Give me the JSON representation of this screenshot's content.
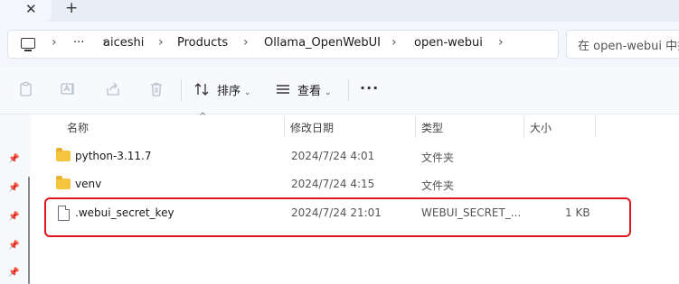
{
  "tabstrip": {
    "close_glyph": "✕",
    "new_tab_glyph": "+"
  },
  "breadcrumb": [
    "aiceshi",
    "Products",
    "Ollama_OpenWebUI",
    "open-webui"
  ],
  "breadcrumb_overflow": "···",
  "search": {
    "placeholder": "在 open-webui 中搜索"
  },
  "toolbar": {
    "sort_label": "排序",
    "view_label": "查看",
    "more_label": "···"
  },
  "columns": {
    "name": "名称",
    "modified": "修改日期",
    "type": "类型",
    "size": "大小"
  },
  "files": [
    {
      "name": "python-3.11.7",
      "modified": "2024/7/24 4:01",
      "type": "文件夹",
      "size": "",
      "icon": "folder-icon"
    },
    {
      "name": "venv",
      "modified": "2024/7/24 4:15",
      "type": "文件夹",
      "size": "",
      "icon": "folder-icon"
    },
    {
      "name": ".webui_secret_key",
      "modified": "2024/7/24 21:01",
      "type": "WEBUI_SECRET_...",
      "size": "1 KB",
      "icon": "file-icon",
      "highlighted": true
    }
  ],
  "highlight_color": "#e0141e",
  "folder_color": "#f6c53f"
}
